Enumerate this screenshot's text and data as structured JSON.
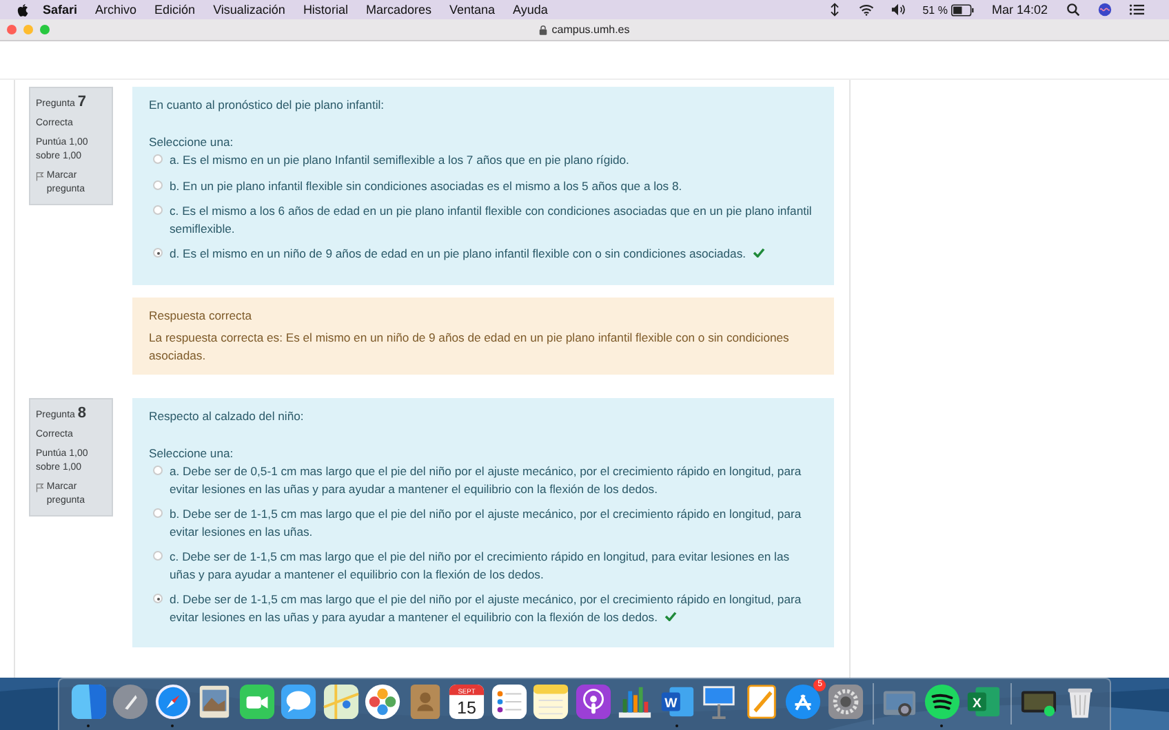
{
  "menu_bar": {
    "app": "Safari",
    "items": [
      "Archivo",
      "Edición",
      "Visualización",
      "Historial",
      "Marcadores",
      "Ventana",
      "Ayuda"
    ],
    "battery": "51 %",
    "clock": "Mar 14:02"
  },
  "browser": {
    "address": "campus.umh.es"
  },
  "questions": [
    {
      "label": "Pregunta",
      "number": "7",
      "status": "Correcta",
      "score": "Puntúa 1,00 sobre 1,00",
      "flag": "Marcar pregunta",
      "prompt": "En cuanto al pronóstico del pie plano infantil:",
      "instruction": "Seleccione una:",
      "options": [
        {
          "text": "a. Es el mismo en un pie plano Infantil semiflexible a los 7 años que en pie plano rígido.",
          "selected": false
        },
        {
          "text": "b. En un pie plano infantil flexible sin condiciones asociadas es el mismo a los 5 años que a los 8.",
          "selected": false
        },
        {
          "text": "c. Es el mismo a los 6 años de edad en un pie plano infantil flexible con condiciones asociadas que en un pie plano infantil semiflexible.",
          "selected": false
        },
        {
          "text": "d. Es el mismo en un niño de 9 años de edad en un pie plano infantil flexible con o sin condiciones asociadas.",
          "selected": true
        }
      ],
      "feedback": {
        "title": "Respuesta correcta",
        "text": "La respuesta correcta es: Es el mismo en un niño de 9 años de edad en un pie plano infantil flexible con o sin condiciones asociadas."
      }
    },
    {
      "label": "Pregunta",
      "number": "8",
      "status": "Correcta",
      "score": "Puntúa 1,00 sobre 1,00",
      "flag": "Marcar pregunta",
      "prompt": "Respecto al calzado del niño:",
      "instruction": "Seleccione una:",
      "options": [
        {
          "text": "a. Debe ser de 0,5-1 cm mas largo que el pie del niño por el ajuste mecánico, por el crecimiento rápido  en longitud, para evitar lesiones en las uñas y para ayudar a mantener el equilibrio con la flexión de los dedos.",
          "selected": false
        },
        {
          "text": "b. Debe ser de 1-1,5 cm mas largo que el pie del niño por el ajuste mecánico, por el crecimiento rápido  en longitud, para evitar  lesiones en las uñas.",
          "selected": false
        },
        {
          "text": "c. Debe ser de 1-1,5 cm mas largo que el pie del niño  por el crecimiento rápido  en longitud, para evitar lesiones en las uñas y para ayudar a mantener el equilibrio con la flexión de los dedos.",
          "selected": false
        },
        {
          "text": "d. Debe ser de 1-1,5 cm mas largo que el pie del niño por el ajuste mecánico, por el crecimiento rápido  en longitud, para evitar  lesiones en las uñas y para ayudar a mantener el equilibrio con la flexión de los dedos.",
          "selected": true
        }
      ]
    }
  ],
  "dock": [
    {
      "kind": "finder",
      "running": true
    },
    {
      "kind": "launchpad",
      "running": false
    },
    {
      "kind": "safari",
      "running": true
    },
    {
      "kind": "preview",
      "running": false
    },
    {
      "kind": "facetime",
      "running": false
    },
    {
      "kind": "messages",
      "running": false
    },
    {
      "kind": "maps",
      "running": false
    },
    {
      "kind": "photos",
      "running": false
    },
    {
      "kind": "contacts",
      "running": false
    },
    {
      "kind": "calendar",
      "running": false,
      "month": "SEPT",
      "day": "15"
    },
    {
      "kind": "reminders",
      "running": false
    },
    {
      "kind": "notes",
      "running": false
    },
    {
      "kind": "podcasts",
      "running": false
    },
    {
      "kind": "numbers",
      "running": false
    },
    {
      "kind": "word",
      "running": true,
      "glyph": "W"
    },
    {
      "kind": "keynote",
      "running": false
    },
    {
      "kind": "pages",
      "running": false
    },
    {
      "kind": "appstore",
      "running": false,
      "badge": "5"
    },
    {
      "kind": "settings",
      "running": false
    },
    {
      "kind": "separator"
    },
    {
      "kind": "imagecapture",
      "running": false
    },
    {
      "kind": "spotify",
      "running": true
    },
    {
      "kind": "excel",
      "running": false,
      "glyph": "X"
    },
    {
      "kind": "separator"
    },
    {
      "kind": "screen",
      "running": false
    },
    {
      "kind": "trash",
      "running": false
    }
  ]
}
